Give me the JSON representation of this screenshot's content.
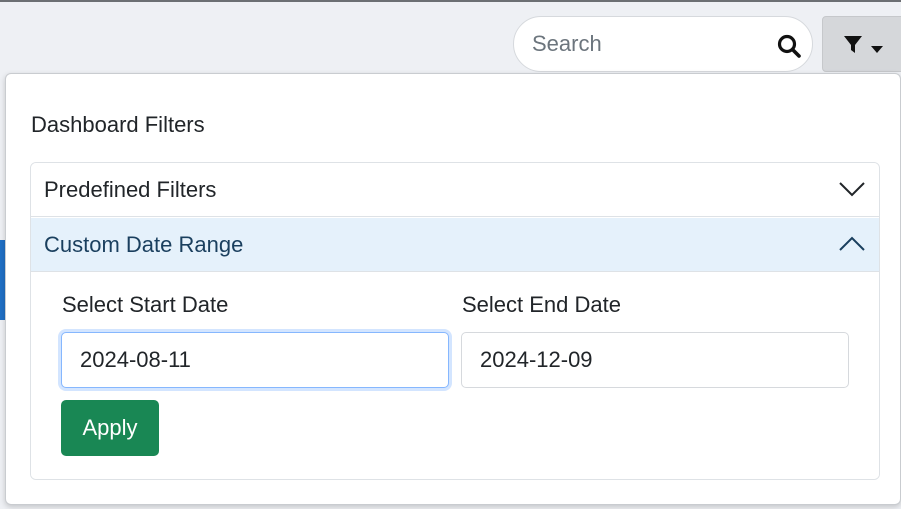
{
  "header": {
    "search": {
      "placeholder": "Search",
      "value": ""
    },
    "filter_button": {
      "icon": "filter-icon",
      "caret": "caret-down-icon"
    }
  },
  "dropdown": {
    "title": "Dashboard Filters",
    "sections": [
      {
        "label": "Predefined Filters",
        "expanded": false,
        "icon": "chevron-down-icon"
      },
      {
        "label": "Custom Date Range",
        "expanded": true,
        "icon": "chevron-up-icon"
      }
    ],
    "custom_range": {
      "start_label": "Select Start Date",
      "start_value": "2024-08-11",
      "end_label": "Select End Date",
      "end_value": "2024-12-09",
      "apply_label": "Apply"
    }
  },
  "colors": {
    "apply_button": "#198754",
    "expanded_header_bg": "#e5f1fb",
    "focus_border": "#86b7fe"
  }
}
